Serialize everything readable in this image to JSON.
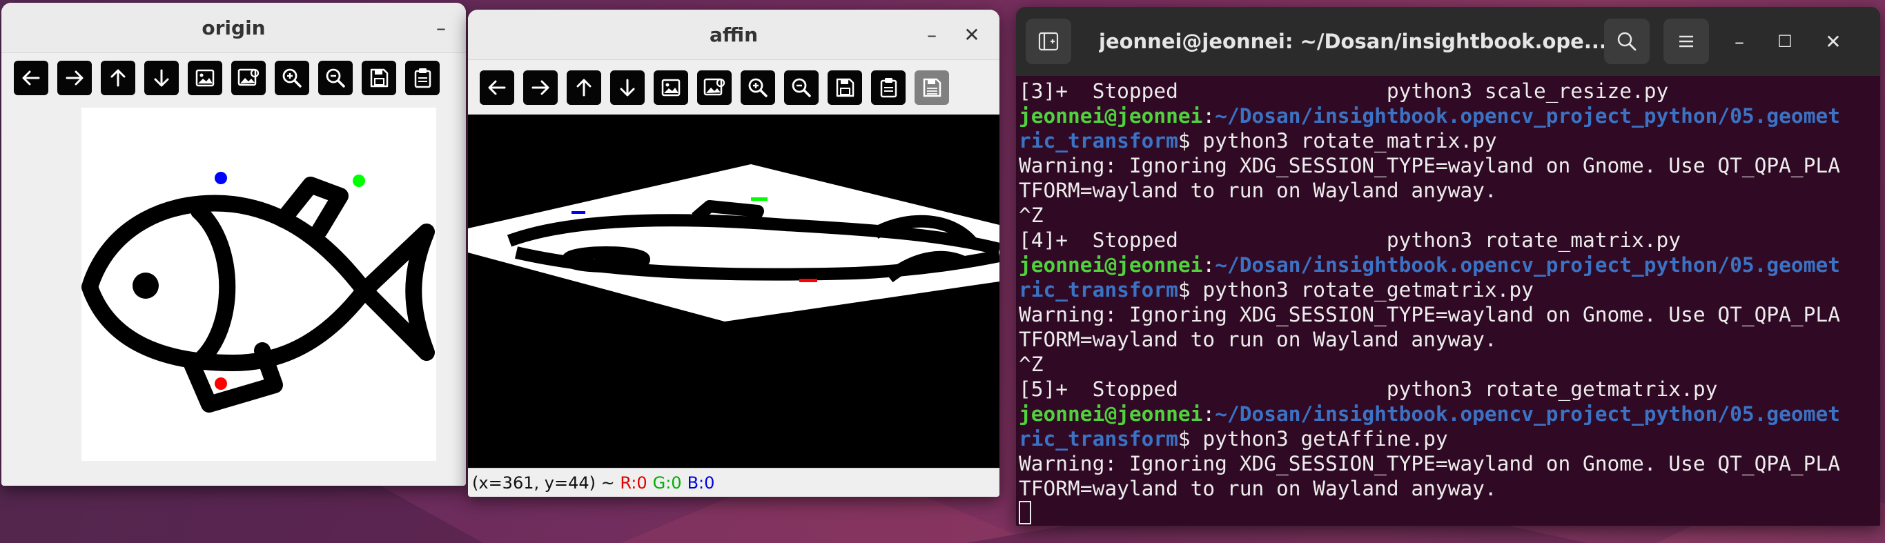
{
  "origin_window": {
    "title": "origin",
    "minimize_label": "–",
    "toolbar": [
      "arrow-left-icon",
      "arrow-right-icon",
      "arrow-up-icon",
      "arrow-down-icon",
      "image-icon",
      "image-settings-icon",
      "zoom-in-icon",
      "zoom-out-icon",
      "save-icon",
      "clipboard-icon"
    ]
  },
  "affin_window": {
    "title": "affin",
    "minimize_label": "–",
    "close_label": "✕",
    "toolbar": [
      "arrow-left-icon",
      "arrow-right-icon",
      "arrow-up-icon",
      "arrow-down-icon",
      "image-icon",
      "image-settings-icon",
      "zoom-in-icon",
      "zoom-out-icon",
      "save-icon",
      "clipboard-icon",
      "properties-icon"
    ],
    "status": {
      "coords": "(x=361, y=44) ~ ",
      "r": "R:0",
      "g": "G:0",
      "b": "B:0",
      "r_color": "#e00000",
      "g_color": "#00c000",
      "b_color": "#0000e0"
    }
  },
  "terminal": {
    "title": "jeonnei@jeonnei: ~/Dosan/insightbook.ope...",
    "colors": {
      "prompt_user": "#4fd23c",
      "prompt_path": "#3b72c4",
      "background": "#300a24"
    },
    "lines": [
      {
        "t": "text",
        "v": "[3]+  Stopped                 python3 scale_resize.py"
      },
      {
        "t": "prompt",
        "user": "jeonnei@jeonnei",
        "sep": ":",
        "path": "~/Dosan/insightbook.opencv_project_python/05.geomet"
      },
      {
        "t": "prompt2",
        "path": "ric_transform",
        "cmd": "$ python3 rotate_matrix.py"
      },
      {
        "t": "text",
        "v": "Warning: Ignoring XDG_SESSION_TYPE=wayland on Gnome. Use QT_QPA_PLA"
      },
      {
        "t": "text",
        "v": "TFORM=wayland to run on Wayland anyway."
      },
      {
        "t": "text",
        "v": "^Z"
      },
      {
        "t": "text",
        "v": "[4]+  Stopped                 python3 rotate_matrix.py"
      },
      {
        "t": "prompt",
        "user": "jeonnei@jeonnei",
        "sep": ":",
        "path": "~/Dosan/insightbook.opencv_project_python/05.geomet"
      },
      {
        "t": "prompt2",
        "path": "ric_transform",
        "cmd": "$ python3 rotate_getmatrix.py"
      },
      {
        "t": "text",
        "v": "Warning: Ignoring XDG_SESSION_TYPE=wayland on Gnome. Use QT_QPA_PLA"
      },
      {
        "t": "text",
        "v": "TFORM=wayland to run on Wayland anyway."
      },
      {
        "t": "text",
        "v": "^Z"
      },
      {
        "t": "text",
        "v": "[5]+  Stopped                 python3 rotate_getmatrix.py"
      },
      {
        "t": "prompt",
        "user": "jeonnei@jeonnei",
        "sep": ":",
        "path": "~/Dosan/insightbook.opencv_project_python/05.geomet"
      },
      {
        "t": "prompt2",
        "path": "ric_transform",
        "cmd": "$ python3 getAffine.py"
      },
      {
        "t": "text",
        "v": "Warning: Ignoring XDG_SESSION_TYPE=wayland on Gnome. Use QT_QPA_PLA"
      },
      {
        "t": "text",
        "v": "TFORM=wayland to run on Wayland anyway."
      }
    ],
    "controls": {
      "minimize": "–",
      "maximize": "☐",
      "close": "✕"
    }
  }
}
